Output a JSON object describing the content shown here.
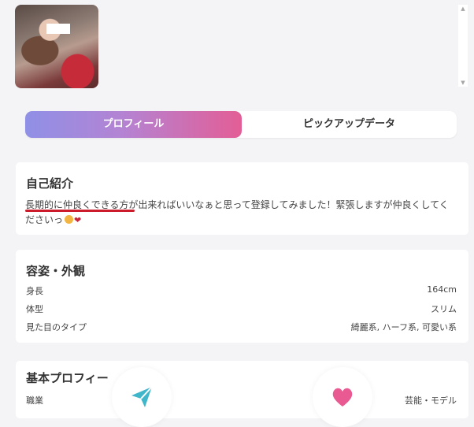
{
  "tabs": {
    "profile": "プロフィール",
    "pickup": "ピックアップデータ"
  },
  "intro": {
    "title": "自己紹介",
    "text_part1": "長期的に仲良くできる方",
    "text_part2": "が出来ればいいなぁと思って登録してみました！緊張しますが仲良くしてくださいっ"
  },
  "appearance": {
    "title": "容姿・外観",
    "rows": [
      {
        "label": "身長",
        "value": "164cm"
      },
      {
        "label": "体型",
        "value": "スリム"
      },
      {
        "label": "見た目のタイプ",
        "value": "綺麗系, ハーフ系, 可愛い系"
      }
    ]
  },
  "basic": {
    "title": "基本プロフィー",
    "rows": [
      {
        "label": "職業",
        "value": "芸能・モデル"
      }
    ]
  },
  "colors": {
    "accent_gradient_start": "#8f90e6",
    "accent_gradient_end": "#e35e96",
    "underline": "#cc1b2b",
    "send_icon": "#3fb6c9",
    "like_icon": "#ea5a92"
  },
  "icons": {
    "send": "paper-plane-icon",
    "like": "heart-icon"
  }
}
